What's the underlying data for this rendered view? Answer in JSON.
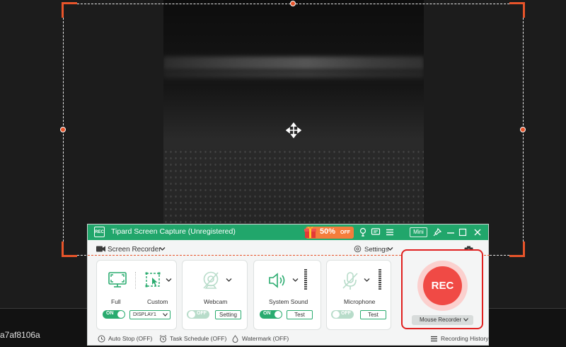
{
  "background": {
    "hash_text": "a7af8106a"
  },
  "window": {
    "title": "Tipard Screen Capture (Unregistered)",
    "logo_text": "REC",
    "promo": {
      "percent": "50%",
      "off": "OFF"
    },
    "mini_label": "Mini",
    "titlebar_icons": [
      "lightbulb-icon",
      "feedback-icon",
      "menu-icon",
      "pin-icon",
      "minimize-icon",
      "close-icon"
    ]
  },
  "toolbar": {
    "mode_label": "Screen Recorder",
    "settings_label": "Settings"
  },
  "area": {
    "full_label": "Full",
    "custom_label": "Custom",
    "full_toggle": "ON",
    "display_select": "DISPLAY1"
  },
  "webcam": {
    "label": "Webcam",
    "toggle": "OFF",
    "button": "Setting"
  },
  "system_sound": {
    "label": "System Sound",
    "toggle": "ON",
    "button": "Test"
  },
  "microphone": {
    "label": "Microphone",
    "toggle": "OFF",
    "button": "Test"
  },
  "record": {
    "rec_label": "REC",
    "mode_select": "Mouse Recorder"
  },
  "footer": {
    "auto_stop": "Auto Stop (OFF)",
    "task_schedule": "Task Schedule (OFF)",
    "watermark": "Watermark (OFF)",
    "history": "Recording History"
  },
  "colors": {
    "brand_green": "#21a66b",
    "selection_orange": "#e8542a",
    "rec_red": "#f04a45",
    "highlight_red": "#e0201f"
  }
}
